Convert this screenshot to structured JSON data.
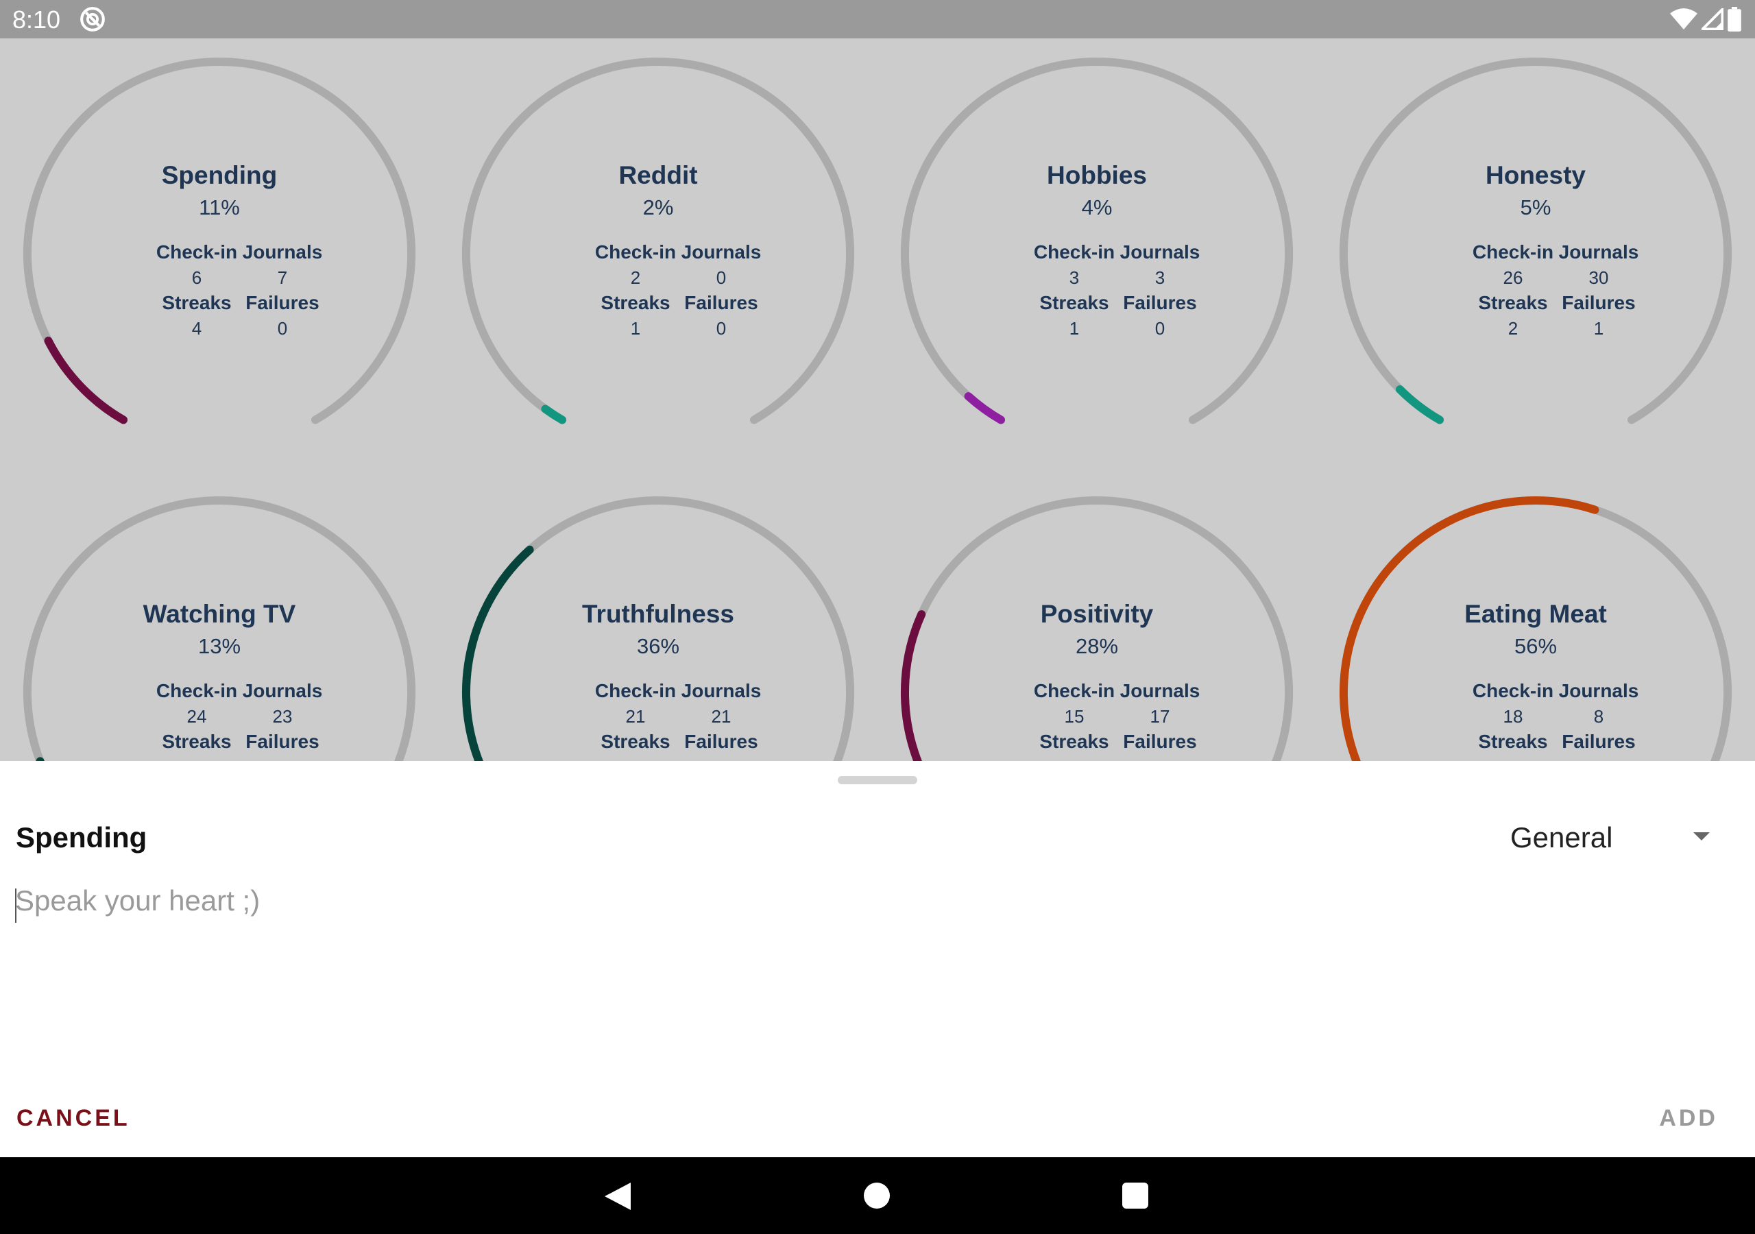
{
  "status_bar": {
    "time": "8:10"
  },
  "cards": [
    {
      "title": "Spending",
      "percent": "11%",
      "checkin": "6",
      "journals": "7",
      "streaks": "4",
      "failures": "0",
      "value": 0.11,
      "color": "#6b0d3e"
    },
    {
      "title": "Reddit",
      "percent": "2%",
      "checkin": "2",
      "journals": "0",
      "streaks": "1",
      "failures": "0",
      "value": 0.02,
      "color": "#129680"
    },
    {
      "title": "Hobbies",
      "percent": "4%",
      "checkin": "3",
      "journals": "3",
      "streaks": "1",
      "failures": "0",
      "value": 0.04,
      "color": "#8e1fa0"
    },
    {
      "title": "Honesty",
      "percent": "5%",
      "checkin": "26",
      "journals": "30",
      "streaks": "2",
      "failures": "1",
      "value": 0.05,
      "color": "#129680"
    },
    {
      "title": "Watching TV",
      "percent": "13%",
      "checkin": "24",
      "journals": "23",
      "streaks": "",
      "failures": "",
      "value": 0.13,
      "color": "#06433b"
    },
    {
      "title": "Truthfulness",
      "percent": "36%",
      "checkin": "21",
      "journals": "21",
      "streaks": "",
      "failures": "",
      "value": 0.36,
      "color": "#06433b"
    },
    {
      "title": "Positivity",
      "percent": "28%",
      "checkin": "15",
      "journals": "17",
      "streaks": "",
      "failures": "",
      "value": 0.28,
      "color": "#6b0d3e"
    },
    {
      "title": "Eating Meat",
      "percent": "56%",
      "checkin": "18",
      "journals": "8",
      "streaks": "",
      "failures": "",
      "value": 0.56,
      "color": "#c0450a"
    }
  ],
  "labels": {
    "checkin": "Check-in",
    "journals": "Journals",
    "streaks": "Streaks",
    "failures": "Failures"
  },
  "sheet": {
    "title": "Spending",
    "category": "General",
    "input_placeholder": "Speak your heart ;)",
    "cancel_label": "CANCEL",
    "add_label": "ADD"
  },
  "colors": {
    "track": "#ababab",
    "text": "#1f3554",
    "cancel": "#7a0f18"
  }
}
